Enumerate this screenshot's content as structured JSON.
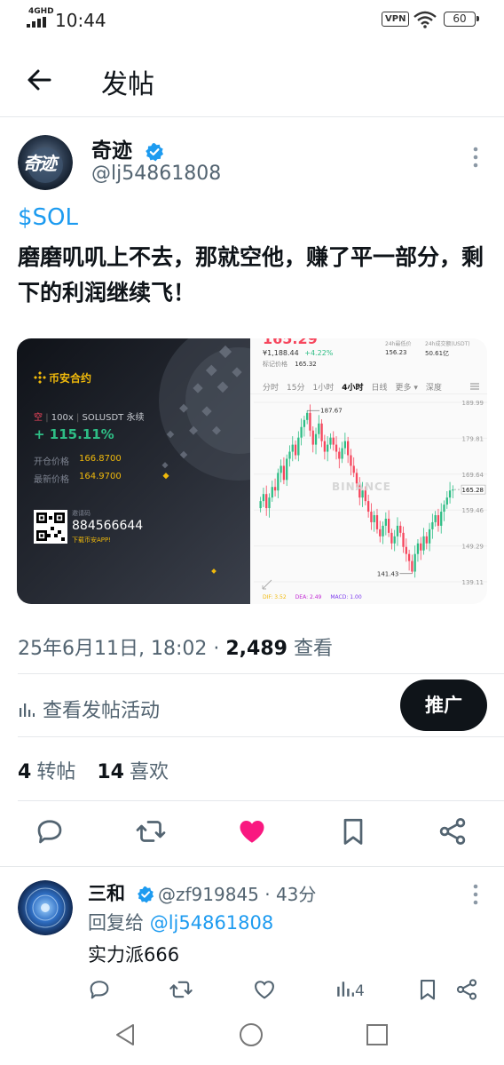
{
  "status_bar": {
    "network": "4GHD",
    "time": "10:44",
    "vpn": "VPN",
    "battery": "60"
  },
  "header": {
    "title": "发帖"
  },
  "post": {
    "author_name": "奇迹",
    "author_handle": "@lj54861808",
    "avatar_text": "奇迹",
    "cashtag": "$SOL",
    "text": "磨磨叽叽上不去，那就空他，赚了平一部分，剩下的利润继续飞！",
    "date": "25年6月11日, 18:02 · ",
    "views": "2,489",
    "views_label": " 查看",
    "activity_label": "查看发帖活动",
    "promote_label": "推广",
    "reposts_count": "4",
    "reposts_label": "转帖",
    "likes_count": "14",
    "likes_label": "喜欢"
  },
  "media_card": {
    "brand": "币安合约",
    "direction": "空",
    "leverage": "100x",
    "pair": "SOLUSDT 永续",
    "pnl": "+ 115.11%",
    "open_label": "开仓价格",
    "open_price": "166.8700",
    "last_label": "最新价格",
    "last_price": "164.9700",
    "invite_label": "邀请码",
    "invite_code": "884566644",
    "download": "下载币安APP!"
  },
  "chart_panel": {
    "price_top": "165.29",
    "price_cny": "¥1,188.44",
    "change": "+4.22%",
    "mark_label": "标记价格",
    "mark_price": "165.32",
    "low24_label": "24h最低价",
    "low24": "156.23",
    "vol24_label": "24h成交额(USDT)",
    "vol24": "50.61亿",
    "tabs": [
      "分时",
      "15分",
      "1小时",
      "4小时",
      "日线",
      "更多 ▾",
      "深度"
    ],
    "active_tab": "4小时",
    "watermark": "BINANCE",
    "high_label": "187.67",
    "low_label": "141.43",
    "current_label": "165.28",
    "yaxis": [
      "189.99",
      "179.81",
      "169.64",
      "159.46",
      "149.29",
      "139.11"
    ],
    "indicators": [
      "DIF: 3.52",
      "DEA: 2.49",
      "MACD: 1.00"
    ]
  },
  "chart_data": {
    "type": "candlestick",
    "title": "",
    "ylim": [
      139.11,
      189.99
    ],
    "yticks": [
      189.99,
      179.81,
      169.64,
      159.46,
      149.29,
      139.11
    ],
    "annotations": [
      {
        "label": "187.67",
        "value": 187.67
      },
      {
        "label": "141.43",
        "value": 141.43
      },
      {
        "label": "165.28",
        "value": 165.28
      }
    ],
    "close_series": [
      162,
      164,
      160,
      163,
      166,
      165,
      170,
      172,
      168,
      174,
      176,
      178,
      175,
      180,
      183,
      185,
      187,
      182,
      178,
      181,
      184,
      179,
      176,
      178,
      180,
      178,
      176,
      174,
      177,
      179,
      175,
      172,
      170,
      167,
      163,
      165,
      162,
      159,
      156,
      158,
      154,
      152,
      155,
      157,
      153,
      150,
      152,
      155,
      153,
      149,
      147,
      145,
      142,
      147,
      150,
      148,
      152,
      150,
      154,
      156,
      158,
      155,
      159,
      161,
      163,
      165,
      165.28
    ]
  },
  "reply": {
    "name": "三和",
    "handle": "@zf919845 · 43分",
    "reply_prefix": "回复给 ",
    "reply_to": "@lj54861808",
    "text": "实力派666",
    "views": "4"
  },
  "colors": {
    "accent": "#1d9bf0",
    "like": "#f91880",
    "up": "#2ebd85",
    "down": "#f6465d",
    "binance": "#f0b90b"
  }
}
